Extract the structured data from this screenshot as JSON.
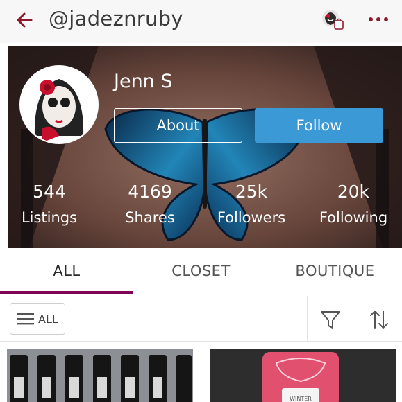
{
  "header": {
    "username": "@jadeznruby",
    "back_icon": "arrow-left-icon",
    "more_icon": "more-dots-icon",
    "accent": "#8b1a2b"
  },
  "profile": {
    "display_name": "Jenn S",
    "about_label": "About",
    "follow_label": "Follow",
    "follow_color": "#3b9ad6",
    "stats": [
      {
        "value": "544",
        "label": "Listings"
      },
      {
        "value": "4169",
        "label": "Shares"
      },
      {
        "value": "25k",
        "label": "Followers"
      },
      {
        "value": "20k",
        "label": "Following"
      }
    ]
  },
  "tabs": [
    {
      "label": "ALL",
      "active": true
    },
    {
      "label": "CLOSET",
      "active": false
    },
    {
      "label": "BOUTIQUE",
      "active": false
    }
  ],
  "tab_indicator_color": "#7f0353",
  "filters": {
    "all_label": "ALL",
    "filter_icon": "funnel-icon",
    "sort_icon": "sort-arrows-icon"
  },
  "listings": [
    {
      "name": "mascara-listing",
      "icon": "product-photo"
    },
    {
      "name": "winter-lotion-listing",
      "product_text": "WINTER"
    }
  ]
}
